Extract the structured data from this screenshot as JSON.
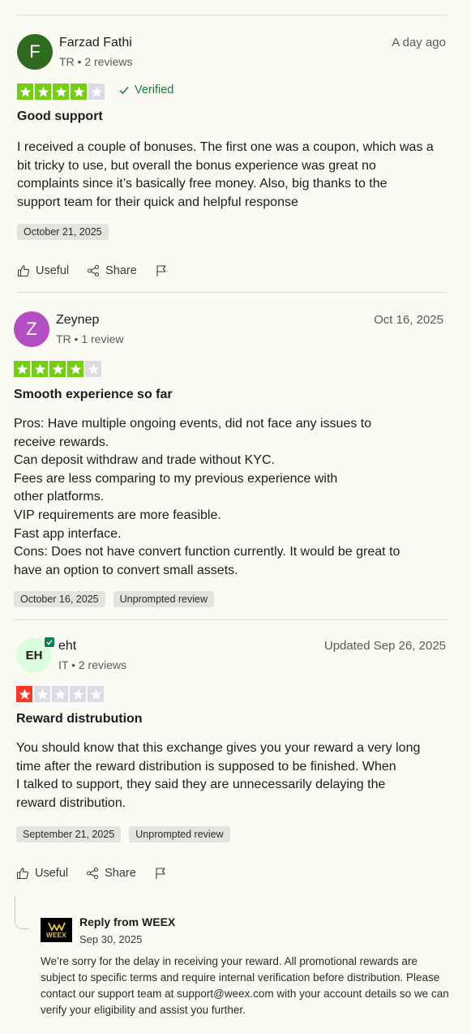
{
  "colors": {
    "star_green": "#73cf11",
    "star_lime": "#73cf11",
    "star_red": "#ff3722",
    "star_empty": "#dcdce6",
    "verified": "#1b7a3a"
  },
  "reviews": [
    {
      "avatar_letter": "F",
      "avatar_color": "#2e6b1f",
      "name": "Farzad Fathi",
      "meta": "TR • 2 reviews",
      "date": "A day ago",
      "rating": 4,
      "verified_label": "Verified",
      "title": "Good support",
      "body": "I received a couple of bonuses. The first one was a coupon, which was a\nbit tricky to use, but overall the bonus experience was great no\ncomplaints since it’s basically free money. Also, big thanks to the\nsupport team for their quick and helpful response",
      "tags": [
        "October 21, 2025"
      ],
      "actions": {
        "useful": "Useful",
        "share": "Share"
      }
    },
    {
      "avatar_letter": "Z",
      "avatar_color": "#b44fc3",
      "name": "Zeynep",
      "meta": "TR • 1 review",
      "date": "Oct 16, 2025",
      "rating": 4,
      "title": "Smooth experience so far",
      "body": "Pros: Have multiple ongoing events, did not face any issues to\nreceive rewards.\nCan deposit withdraw and trade without KYC.\nFees are less comparing to my previous experience with\nother platforms.\nVIP requirements are more feasible.\nFast app interface.\nCons: Does not have convert function currently. It would be great to\nhave an option to convert small assets.",
      "tags": [
        "October 16, 2025",
        "Unprompted review"
      ]
    },
    {
      "avatar_letter": "EH",
      "avatar_color": "#dcfce0",
      "name": "eht",
      "meta": "IT • 2 reviews",
      "date": "Updated Sep 26, 2025",
      "rating": 1,
      "title": "Reward distrubution",
      "body": "You should know that this exchange gives you your reward a very long\ntime after the reward distribution is supposed to be finished. When\nI talked to support, they said they are unnecessarily delaying the\nreward distribution.",
      "tags": [
        "September 21, 2025",
        "Unprompted review"
      ],
      "actions": {
        "useful": "Useful",
        "share": "Share"
      }
    }
  ],
  "reply": {
    "logo_text": "WEEX",
    "from": "Reply from WEEX",
    "date": "Sep 30, 2025",
    "body": "We’re sorry for the delay in receiving your reward. All promotional rewards are subject to specific terms and require internal verification before distribution. Please contact our support team at support@weex.com with your account details so we can verify your eligibility and assist you further."
  }
}
